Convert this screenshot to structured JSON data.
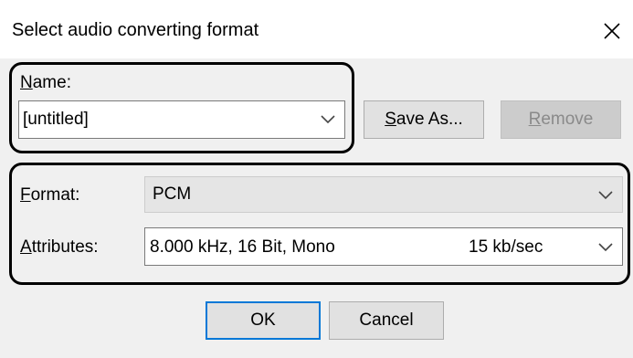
{
  "dialog": {
    "title": "Select audio converting format",
    "close_icon": "close-icon"
  },
  "name_section": {
    "label_prefix": "N",
    "label_rest": "ame:",
    "value": "[untitled]",
    "save_as_prefix": "S",
    "save_as_rest": "ave As...",
    "remove_prefix": "R",
    "remove_rest": "emove"
  },
  "format_section": {
    "format_label_prefix": "F",
    "format_label_rest": "ormat:",
    "format_value": "PCM",
    "attributes_label_prefix": "A",
    "attributes_label_rest": "ttributes:",
    "attributes_value": "8.000 kHz, 16 Bit, Mono",
    "attributes_rate": "15 kb/sec"
  },
  "footer": {
    "ok_label": "OK",
    "cancel_label": "Cancel"
  }
}
